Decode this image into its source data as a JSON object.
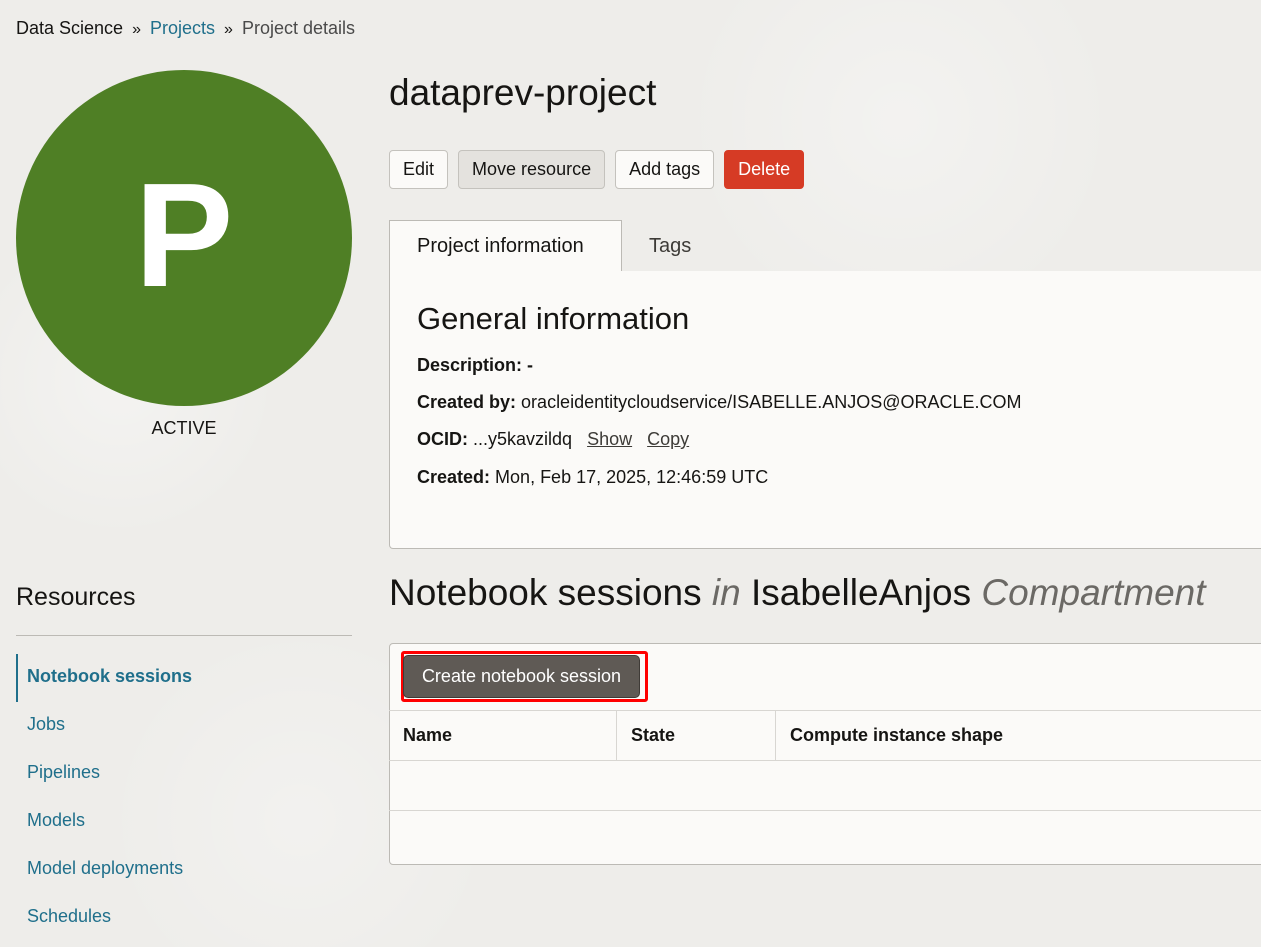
{
  "breadcrumb": {
    "root": "Data Science",
    "separator": "»",
    "projects": "Projects",
    "current": "Project details"
  },
  "avatar": {
    "letter": "P",
    "color": "#4f7f25"
  },
  "status": "ACTIVE",
  "title": "dataprev-project",
  "actions": {
    "edit": "Edit",
    "move": "Move resource",
    "add_tags": "Add tags",
    "delete": "Delete"
  },
  "tabs": [
    {
      "label": "Project information",
      "active": true
    },
    {
      "label": "Tags",
      "active": false
    }
  ],
  "general": {
    "heading": "General information",
    "description_label": "Description:",
    "description_value": "-",
    "created_by_label": "Created by:",
    "created_by_value": "oracleidentitycloudservice/ISABELLE.ANJOS@ORACLE.COM",
    "ocid_label": "OCID:",
    "ocid_value": "...y5kavzildq",
    "show_link": "Show",
    "copy_link": "Copy",
    "created_label": "Created:",
    "created_value": "Mon, Feb 17, 2025, 12:46:59 UTC"
  },
  "resources": {
    "title": "Resources",
    "items": [
      {
        "label": "Notebook sessions",
        "active": true
      },
      {
        "label": "Jobs",
        "active": false
      },
      {
        "label": "Pipelines",
        "active": false
      },
      {
        "label": "Models",
        "active": false
      },
      {
        "label": "Model deployments",
        "active": false
      },
      {
        "label": "Schedules",
        "active": false
      }
    ]
  },
  "notebooks": {
    "title_main": "Notebook sessions",
    "title_in": "in",
    "compartment_name": "IsabelleAnjos",
    "compartment_word": "Compartment",
    "create_button": "Create notebook session",
    "columns": [
      "Name",
      "State",
      "Compute instance shape"
    ]
  },
  "colors": {
    "accent_link": "#1f6f8b",
    "danger": "#d63b25",
    "primary_dark": "#5f5a55",
    "highlight": "#ff0000"
  }
}
